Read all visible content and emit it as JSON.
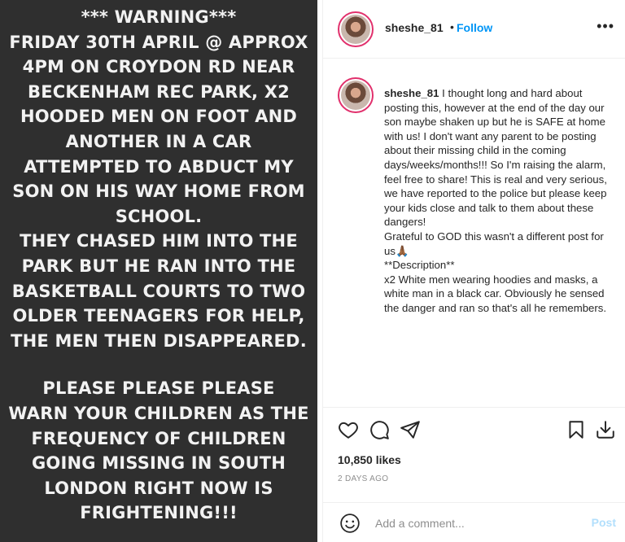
{
  "post_image": {
    "lines_block1": [
      "*** WARNING***",
      "FRIDAY 30TH APRIL @ APPROX",
      "4PM ON CROYDON RD NEAR",
      "BECKENHAM REC PARK, X2",
      "HOODED MEN ON FOOT AND",
      "ANOTHER IN A CAR",
      "ATTEMPTED TO ABDUCT MY",
      "SON ON HIS WAY HOME FROM",
      "SCHOOL.",
      "THEY CHASED HIM INTO THE",
      "PARK BUT HE RAN INTO THE",
      "BASKETBALL COURTS TO TWO",
      "OLDER TEENAGERS FOR HELP,",
      "THE MEN THEN DISAPPEARED."
    ],
    "lines_block2": [
      "PLEASE PLEASE PLEASE",
      "WARN YOUR CHILDREN AS THE",
      "FREQUENCY OF CHILDREN",
      "GOING MISSING IN SOUTH",
      "LONDON  RIGHT NOW IS",
      "FRIGHTENING!!!"
    ]
  },
  "header": {
    "username": "sheshe_81",
    "separator": "•",
    "follow_label": "Follow",
    "more_label": "•••"
  },
  "caption": {
    "username": "sheshe_81",
    "text_part1": "I thought long and hard about posting this, however at the end of the day our son maybe shaken up but he is SAFE at home with us! I don't want any parent to be posting about their missing child in the coming days/weeks/months!!! So I'm raising the alarm, feel free to share! This is real and very serious, we have reported to the police but please keep your kids close and talk to them about these dangers!",
    "text_part2": "Grateful to GOD this wasn't a different post for us",
    "emoji": "🙏🏾",
    "text_part3": "**Description**",
    "text_part4": "x2 White men wearing hoodies and masks, a white man in a black car. Obviously he sensed the danger and ran so that's all he remembers."
  },
  "actions": {
    "icons": [
      "heart-icon",
      "comment-icon",
      "share-icon",
      "bookmark-icon",
      "download-icon"
    ],
    "likes": "10,850 likes",
    "timestamp": "2 DAYS AGO"
  },
  "comment": {
    "placeholder": "Add a comment...",
    "post_label": "Post",
    "emoji_icon": "smiley-icon"
  },
  "colors": {
    "image_bg": "#2f2f2f",
    "image_text": "#f2f2f2",
    "link_blue": "#0095f6",
    "post_disabled": "#b2dffc",
    "story_ring": "#e1306c"
  }
}
